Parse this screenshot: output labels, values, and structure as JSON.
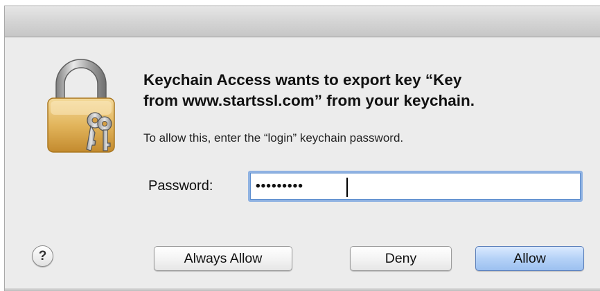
{
  "dialog": {
    "app_icon": "keychain-lock-icon",
    "message_line1": "Keychain Access wants to export key “Key",
    "message_line2": "from www.startssl.com” from your keychain.",
    "info_text": "To allow this, enter the “login” keychain password.",
    "password_label": "Password:",
    "password_value": "•••••••••",
    "help_label": "?",
    "buttons": {
      "always_allow": "Always Allow",
      "deny": "Deny",
      "allow": "Allow"
    }
  },
  "colors": {
    "window_bg": "#ececec",
    "focus_ring": "#8fb2e2",
    "default_button": "#b5d2f7"
  }
}
